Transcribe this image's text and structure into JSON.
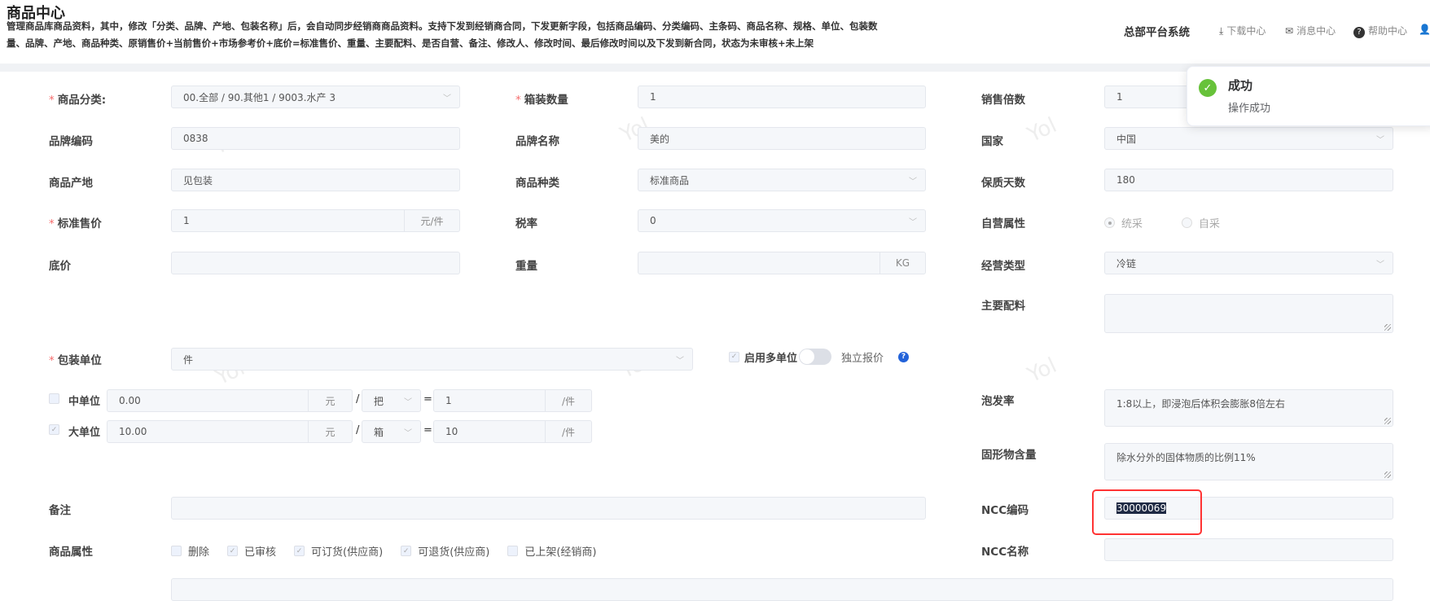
{
  "header": {
    "title": "商品中心",
    "desc_line1": "管理商品库商品资料，其中，修改「分类、品牌、产地、包装名称」后，会自动同步经销商商品资料。支持下发到经销商合同，下发更新字段，包括商品编码、分类编码、主条码、商品名称、规格、单位、包装数",
    "desc_line2": "量、品牌、产地、商品种类、原销售价+当前售价+市场参考价+底价=标准售价、重量、主要配料、是否自营、备注、修改人、修改时间、最后修改时间以及下发到新合同，状态为未审核+未上架",
    "system": "总部平台系统",
    "download": "下载中心",
    "messages": "消息中心",
    "help": "帮助中心",
    "user": "Y"
  },
  "toast": {
    "title": "成功",
    "message": "操作成功",
    "color": "#67c23a"
  },
  "form": {
    "category": {
      "label": "商品分类:",
      "value": "00.全部 / 90.其他1 / 9003.水产 3"
    },
    "box_qty": {
      "label": "箱装数量",
      "value": "1"
    },
    "sale_multiple": {
      "label": "销售倍数",
      "value": "1"
    },
    "brand_code": {
      "label": "品牌编码",
      "value": "0838"
    },
    "brand_name": {
      "label": "品牌名称",
      "value": "美的"
    },
    "country": {
      "label": "国家",
      "value": "中国"
    },
    "origin": {
      "label": "商品产地",
      "value": "见包装"
    },
    "goods_type": {
      "label": "商品种类",
      "value": "标准商品"
    },
    "shelf_days": {
      "label": "保质天数",
      "value": "180"
    },
    "std_price": {
      "label": "标准售价",
      "value": "1",
      "unit": "元/件"
    },
    "tax": {
      "label": "税率",
      "value": "0"
    },
    "self_run": {
      "label": "自营属性",
      "opt1": "统采",
      "opt2": "自采"
    },
    "floor_price": {
      "label": "底价",
      "value": ""
    },
    "weight": {
      "label": "重量",
      "value": "",
      "unit": "KG"
    },
    "biz_type": {
      "label": "经营类型",
      "value": "冷链"
    },
    "ingredients": {
      "label": "主要配料",
      "value": ""
    },
    "pack_unit": {
      "label": "包装单位",
      "value": "件"
    },
    "multi_unit": {
      "label": "启用多单位",
      "independent": "独立报价"
    },
    "mid_unit": {
      "label": "中单位",
      "price": "0.00",
      "currency": "元",
      "unit": "把",
      "qty": "1",
      "per": "/件"
    },
    "big_unit": {
      "label": "大单位",
      "price": "10.00",
      "currency": "元",
      "unit": "箱",
      "qty": "10",
      "per": "/件"
    },
    "soak_rate": {
      "label": "泡发率",
      "value": "1:8以上，即浸泡后体积会膨胀8倍左右"
    },
    "solids": {
      "label": "固形物含量",
      "value": "除水分外的固体物质的比例11%"
    },
    "remark": {
      "label": "备注",
      "value": ""
    },
    "ncc_code": {
      "label": "NCC编码",
      "value": "30000069"
    },
    "ncc_name": {
      "label": "NCC名称",
      "value": ""
    },
    "attrs": {
      "label": "商品属性",
      "items": [
        "删除",
        "已审核",
        "可订货(供应商)",
        "可退货(供应商)",
        "已上架(经销商)"
      ]
    },
    "watermark": "Yol"
  }
}
